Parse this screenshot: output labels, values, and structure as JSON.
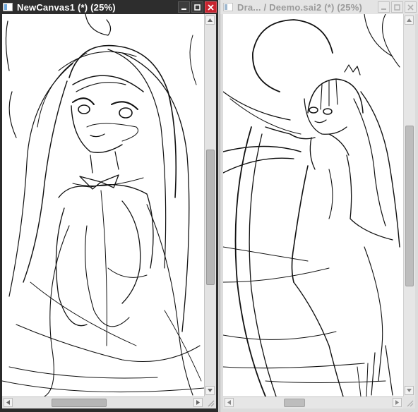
{
  "windows": [
    {
      "title": "NewCanvas1 (*) (25%)",
      "active": true
    },
    {
      "title": "Dra... / Deemo.sai2 (*) (25%)",
      "active": false
    }
  ],
  "icons": {
    "app": "canvas-window-icon",
    "minimize": "minimize-icon",
    "maximize": "maximize-icon",
    "close": "close-icon",
    "scroll_up": "arrow-up-icon",
    "scroll_down": "arrow-down-icon",
    "scroll_left": "arrow-left-icon",
    "scroll_right": "arrow-right-icon",
    "resize": "resize-grip-icon"
  },
  "colors": {
    "active_title_bg": "#2d2d2d",
    "inactive_title_bg": "#e4e4e4",
    "close_button": "#c8242f"
  }
}
